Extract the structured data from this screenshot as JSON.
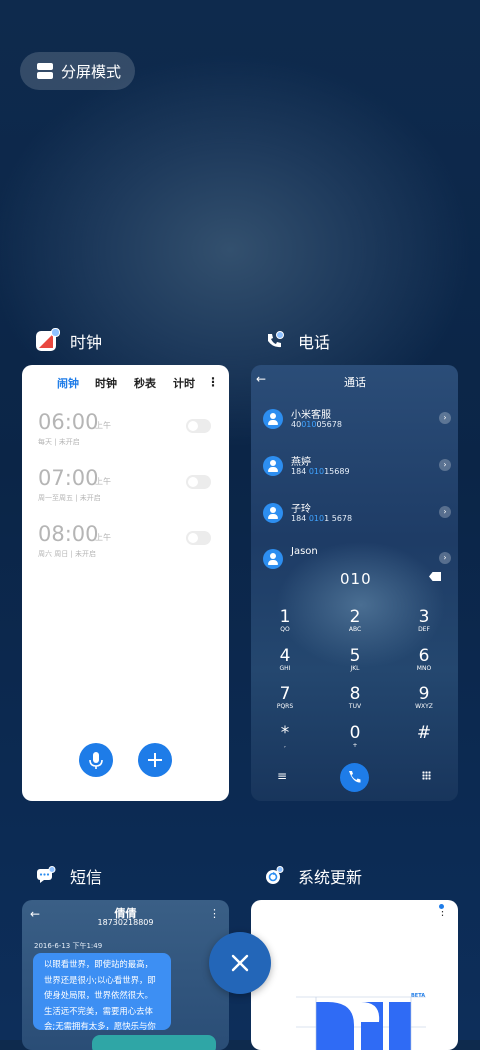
{
  "split_screen": {
    "label": "分屏模式"
  },
  "clock": {
    "title": "时钟",
    "tabs": [
      "闹钟",
      "时钟",
      "秒表",
      "计时"
    ],
    "alarms": [
      {
        "time": "06:00",
        "ampm": "上午",
        "desc": "每天 | 未开启"
      },
      {
        "time": "07:00",
        "ampm": "上午",
        "desc": "周一至周五 | 未开启"
      },
      {
        "time": "08:00",
        "ampm": "上午",
        "desc": "周六 周日 | 未开启"
      }
    ]
  },
  "phone": {
    "title": "电话",
    "header": "通话",
    "contacts": [
      {
        "name": "小米客服",
        "number_pre": "40",
        "number_hl": "010",
        "number_post": "05678"
      },
      {
        "name": "燕婷",
        "number_pre": "184 ",
        "number_hl": "010",
        "number_post": "15689"
      },
      {
        "name": "子玲",
        "number_pre": "184 ",
        "number_hl": "010",
        "number_post": "1 5678"
      },
      {
        "name": "Jason",
        "number_pre": "",
        "number_hl": "",
        "number_post": ""
      }
    ],
    "dial_input": "010",
    "keys": [
      {
        "n": "1",
        "l": "QO"
      },
      {
        "n": "2",
        "l": "ABC"
      },
      {
        "n": "3",
        "l": "DEF"
      },
      {
        "n": "4",
        "l": "GHI"
      },
      {
        "n": "5",
        "l": "JKL"
      },
      {
        "n": "6",
        "l": "MNO"
      },
      {
        "n": "7",
        "l": "PQRS"
      },
      {
        "n": "8",
        "l": "TUV"
      },
      {
        "n": "9",
        "l": "WXYZ"
      },
      {
        "n": "*",
        "l": ","
      },
      {
        "n": "0",
        "l": "+"
      },
      {
        "n": "#",
        "l": ""
      }
    ]
  },
  "sms": {
    "title": "短信",
    "contact_name": "倩倩",
    "contact_number": "18730218809",
    "timestamp": "2016-6-13 下午1:49",
    "message": "以眼看世界，即使站的最高，世界还是很小;以心看世界，即使身处局限，世界依然很大。生活远不完美，需要用心去体会;无需拥有太多，愿快乐与你相随。"
  },
  "update": {
    "title": "系统更新",
    "badge": "BETA"
  },
  "colors": {
    "accent": "#1e7ce8",
    "highlight": "#3fa3ff",
    "close": "#2366b8"
  }
}
